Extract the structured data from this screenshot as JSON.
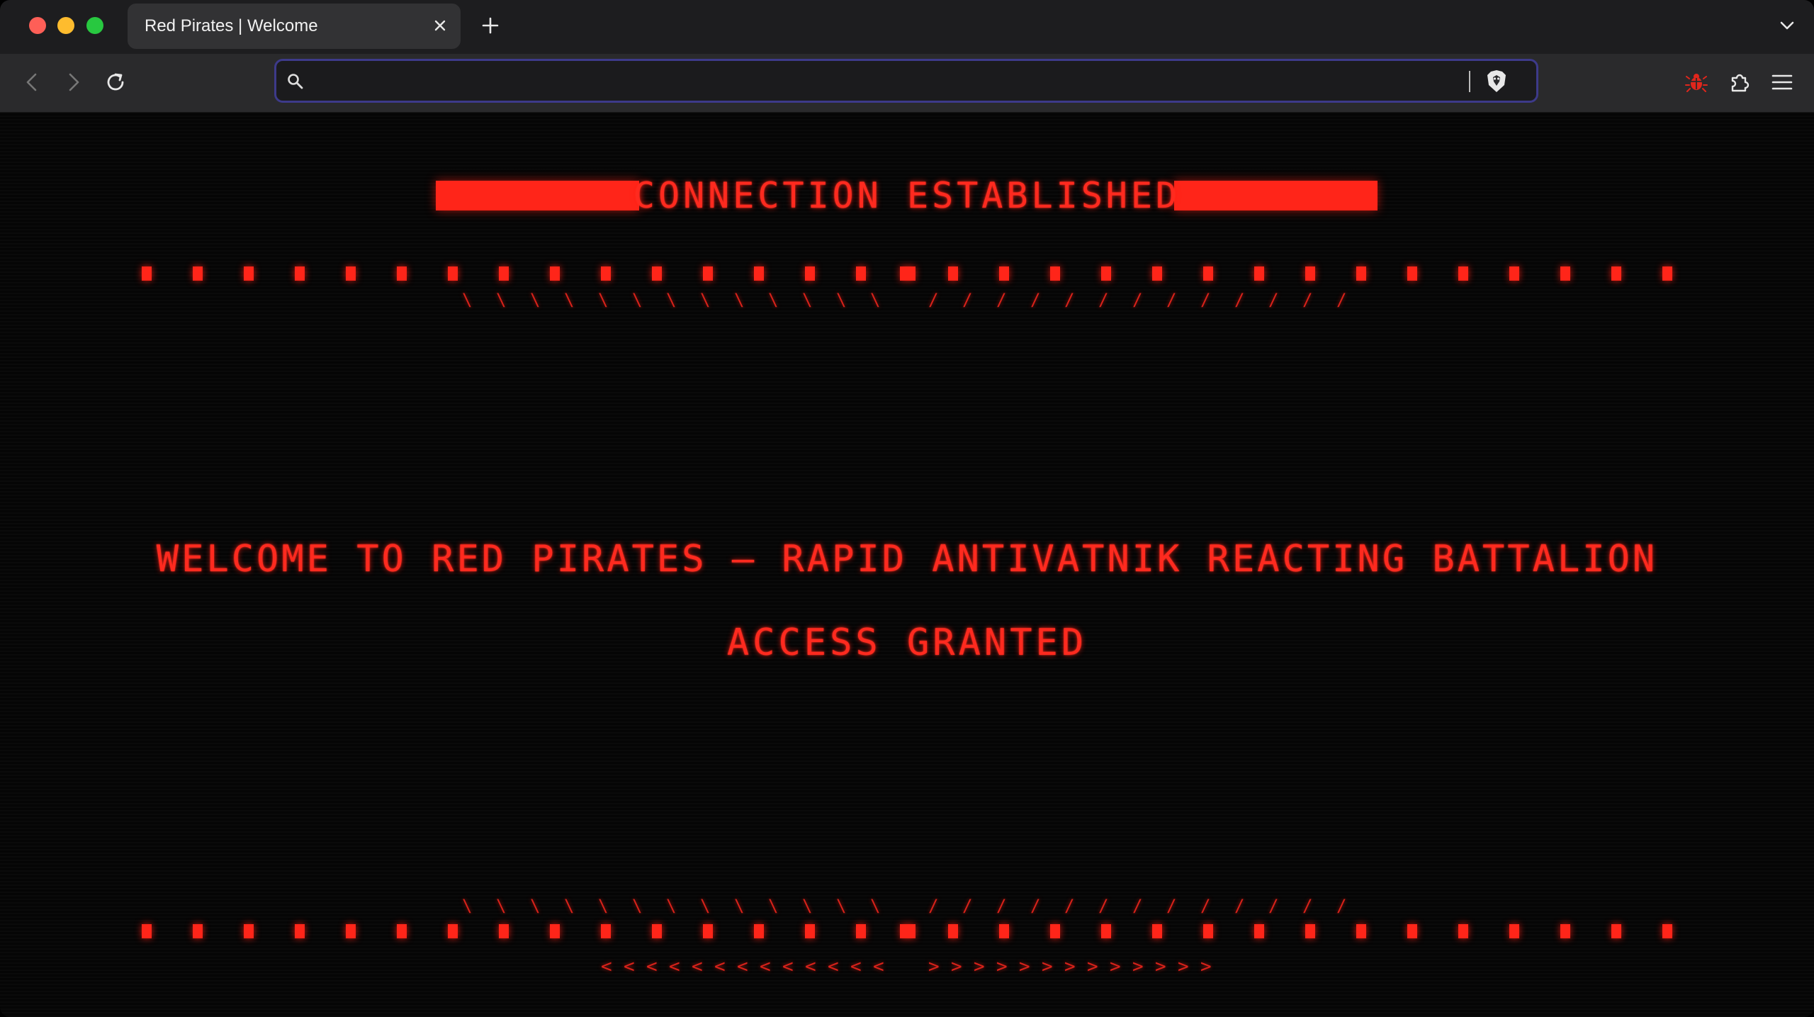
{
  "browser": {
    "tab_title": "Red Pirates | Welcome",
    "url_value": "",
    "url_placeholder": "",
    "icons": [
      "close-icon",
      "plus-icon",
      "chevron-down-icon",
      "back-icon",
      "forward-icon",
      "reload-icon",
      "search-icon",
      "brave-shield-icon",
      "bug-extension-icon",
      "puzzle-icon",
      "menu-icon"
    ]
  },
  "page": {
    "header": "CONNECTION ESTABLISHED",
    "welcome": "WELCOME TO RED PIRATES – RAPID ANTIVATNIK REACTING BATTALION",
    "access": "ACCESS GRANTED",
    "decor": {
      "backslash": "\\",
      "slash": "/",
      "left_chevron": "<",
      "right_chevron": ">"
    }
  },
  "colors": {
    "accent": "#ff2519",
    "background": "#050505",
    "urlbar_border": "#3d3a8a"
  }
}
